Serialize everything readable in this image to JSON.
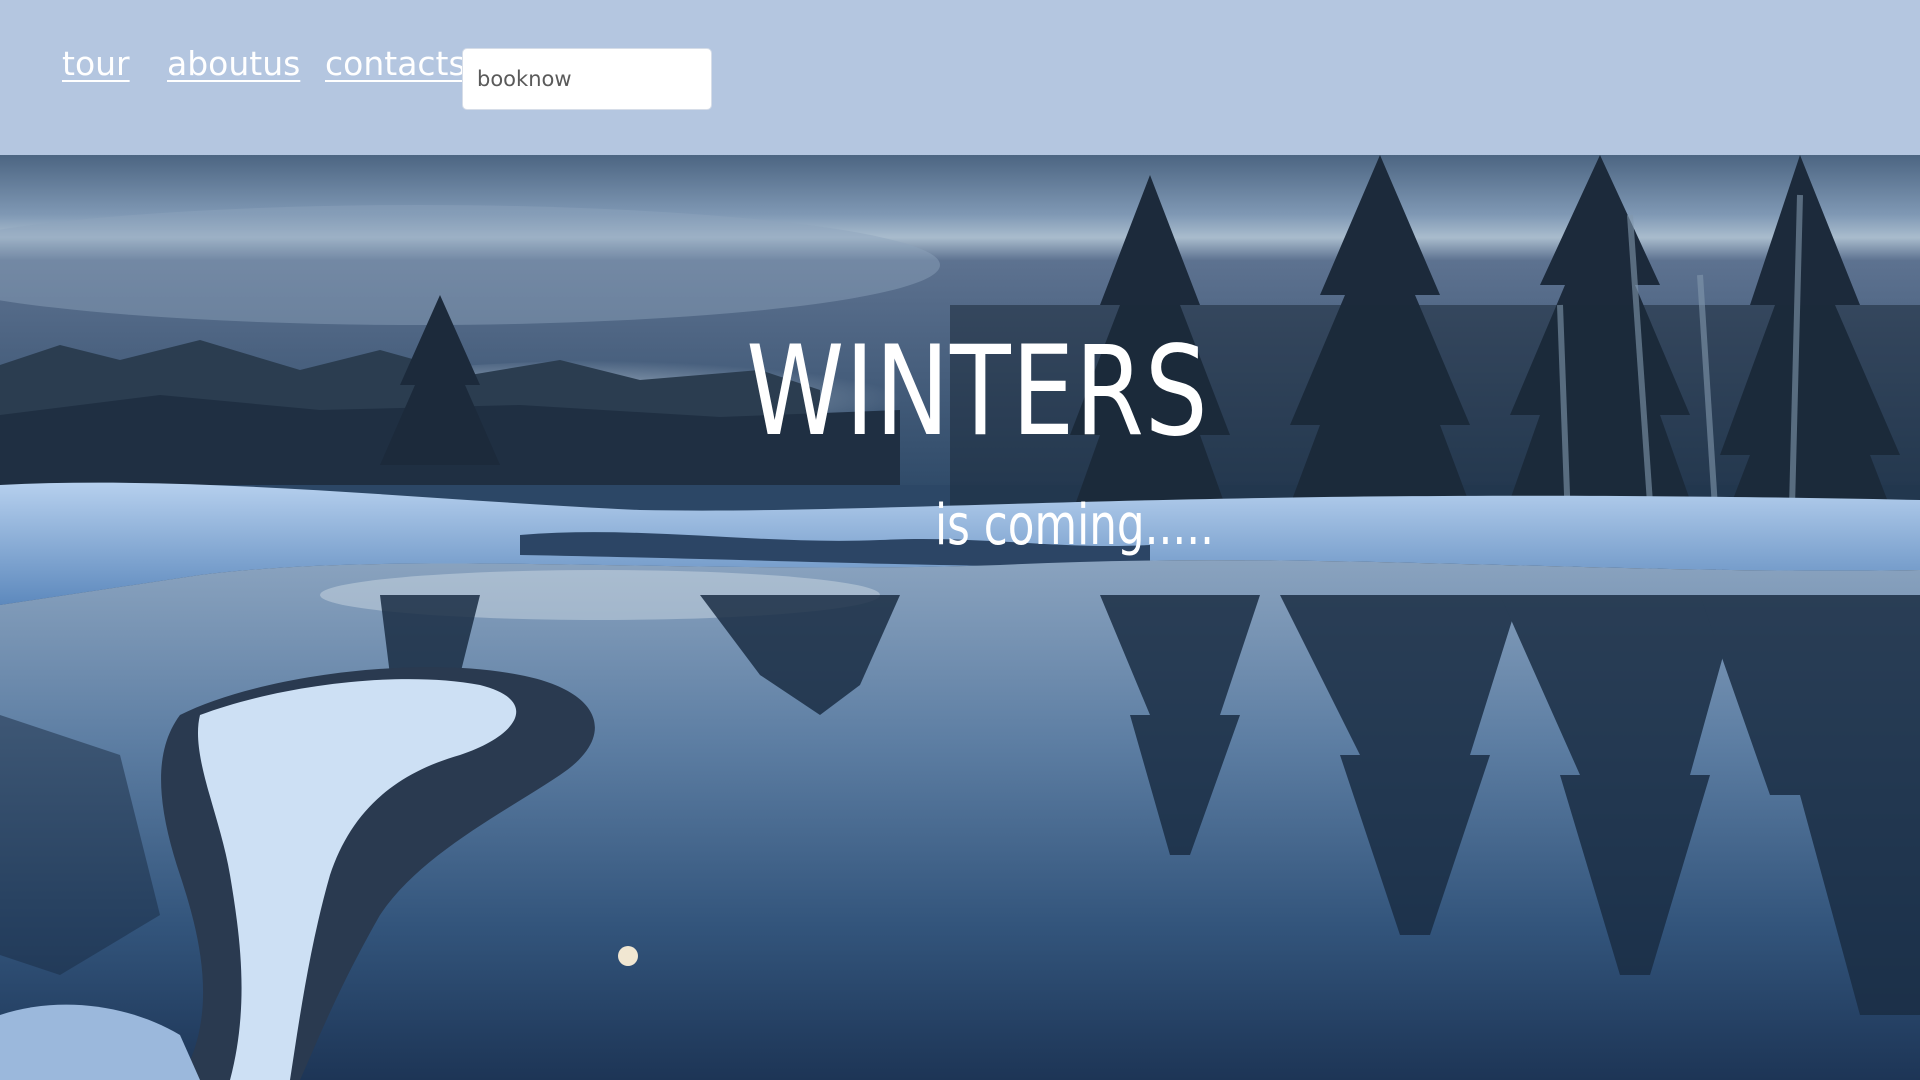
{
  "nav": {
    "links": [
      {
        "label": "tour"
      },
      {
        "label": "aboutus"
      },
      {
        "label": "contacts"
      }
    ],
    "book_input": {
      "placeholder": "booknow",
      "value": ""
    }
  },
  "hero": {
    "title": "WINTERS",
    "subtitle": "is coming....."
  },
  "colors": {
    "navbar_bg": "#b4c6e0",
    "link_text": "#ffffff",
    "hero_text": "#ffffff"
  }
}
